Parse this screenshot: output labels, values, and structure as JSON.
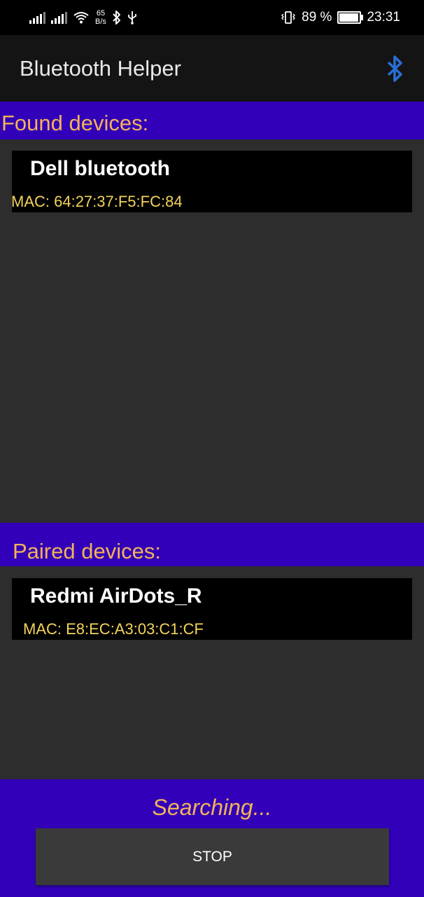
{
  "status_bar": {
    "network_speed_value": "65",
    "network_speed_unit": "B/s",
    "battery_percent": "89 %",
    "battery_level": 0.89,
    "time": "23:31",
    "icons": [
      "signal-icon",
      "signal-icon",
      "wifi-icon",
      "bluetooth-icon",
      "usb-icon",
      "vibrate-icon",
      "battery-charging-icon"
    ]
  },
  "app_bar": {
    "title": "Bluetooth Helper",
    "action_icon": "bluetooth-icon",
    "action_color": "#2a6fd6"
  },
  "found_section": {
    "header": "Found devices:",
    "devices": [
      {
        "name": "Dell bluetooth",
        "mac": "MAC: 64:27:37:F5:FC:84"
      }
    ]
  },
  "paired_section": {
    "header": "Paired devices:",
    "devices": [
      {
        "name": "Redmi AirDots_R",
        "mac": "MAC: E8:EC:A3:03:C1:CF"
      }
    ]
  },
  "footer": {
    "status": "Searching...",
    "stop_label": "STOP"
  },
  "colors": {
    "accent": "#3100b8",
    "header_text": "#f4b25a",
    "mac_text": "#f4d35a",
    "background": "#2d2d2d"
  }
}
